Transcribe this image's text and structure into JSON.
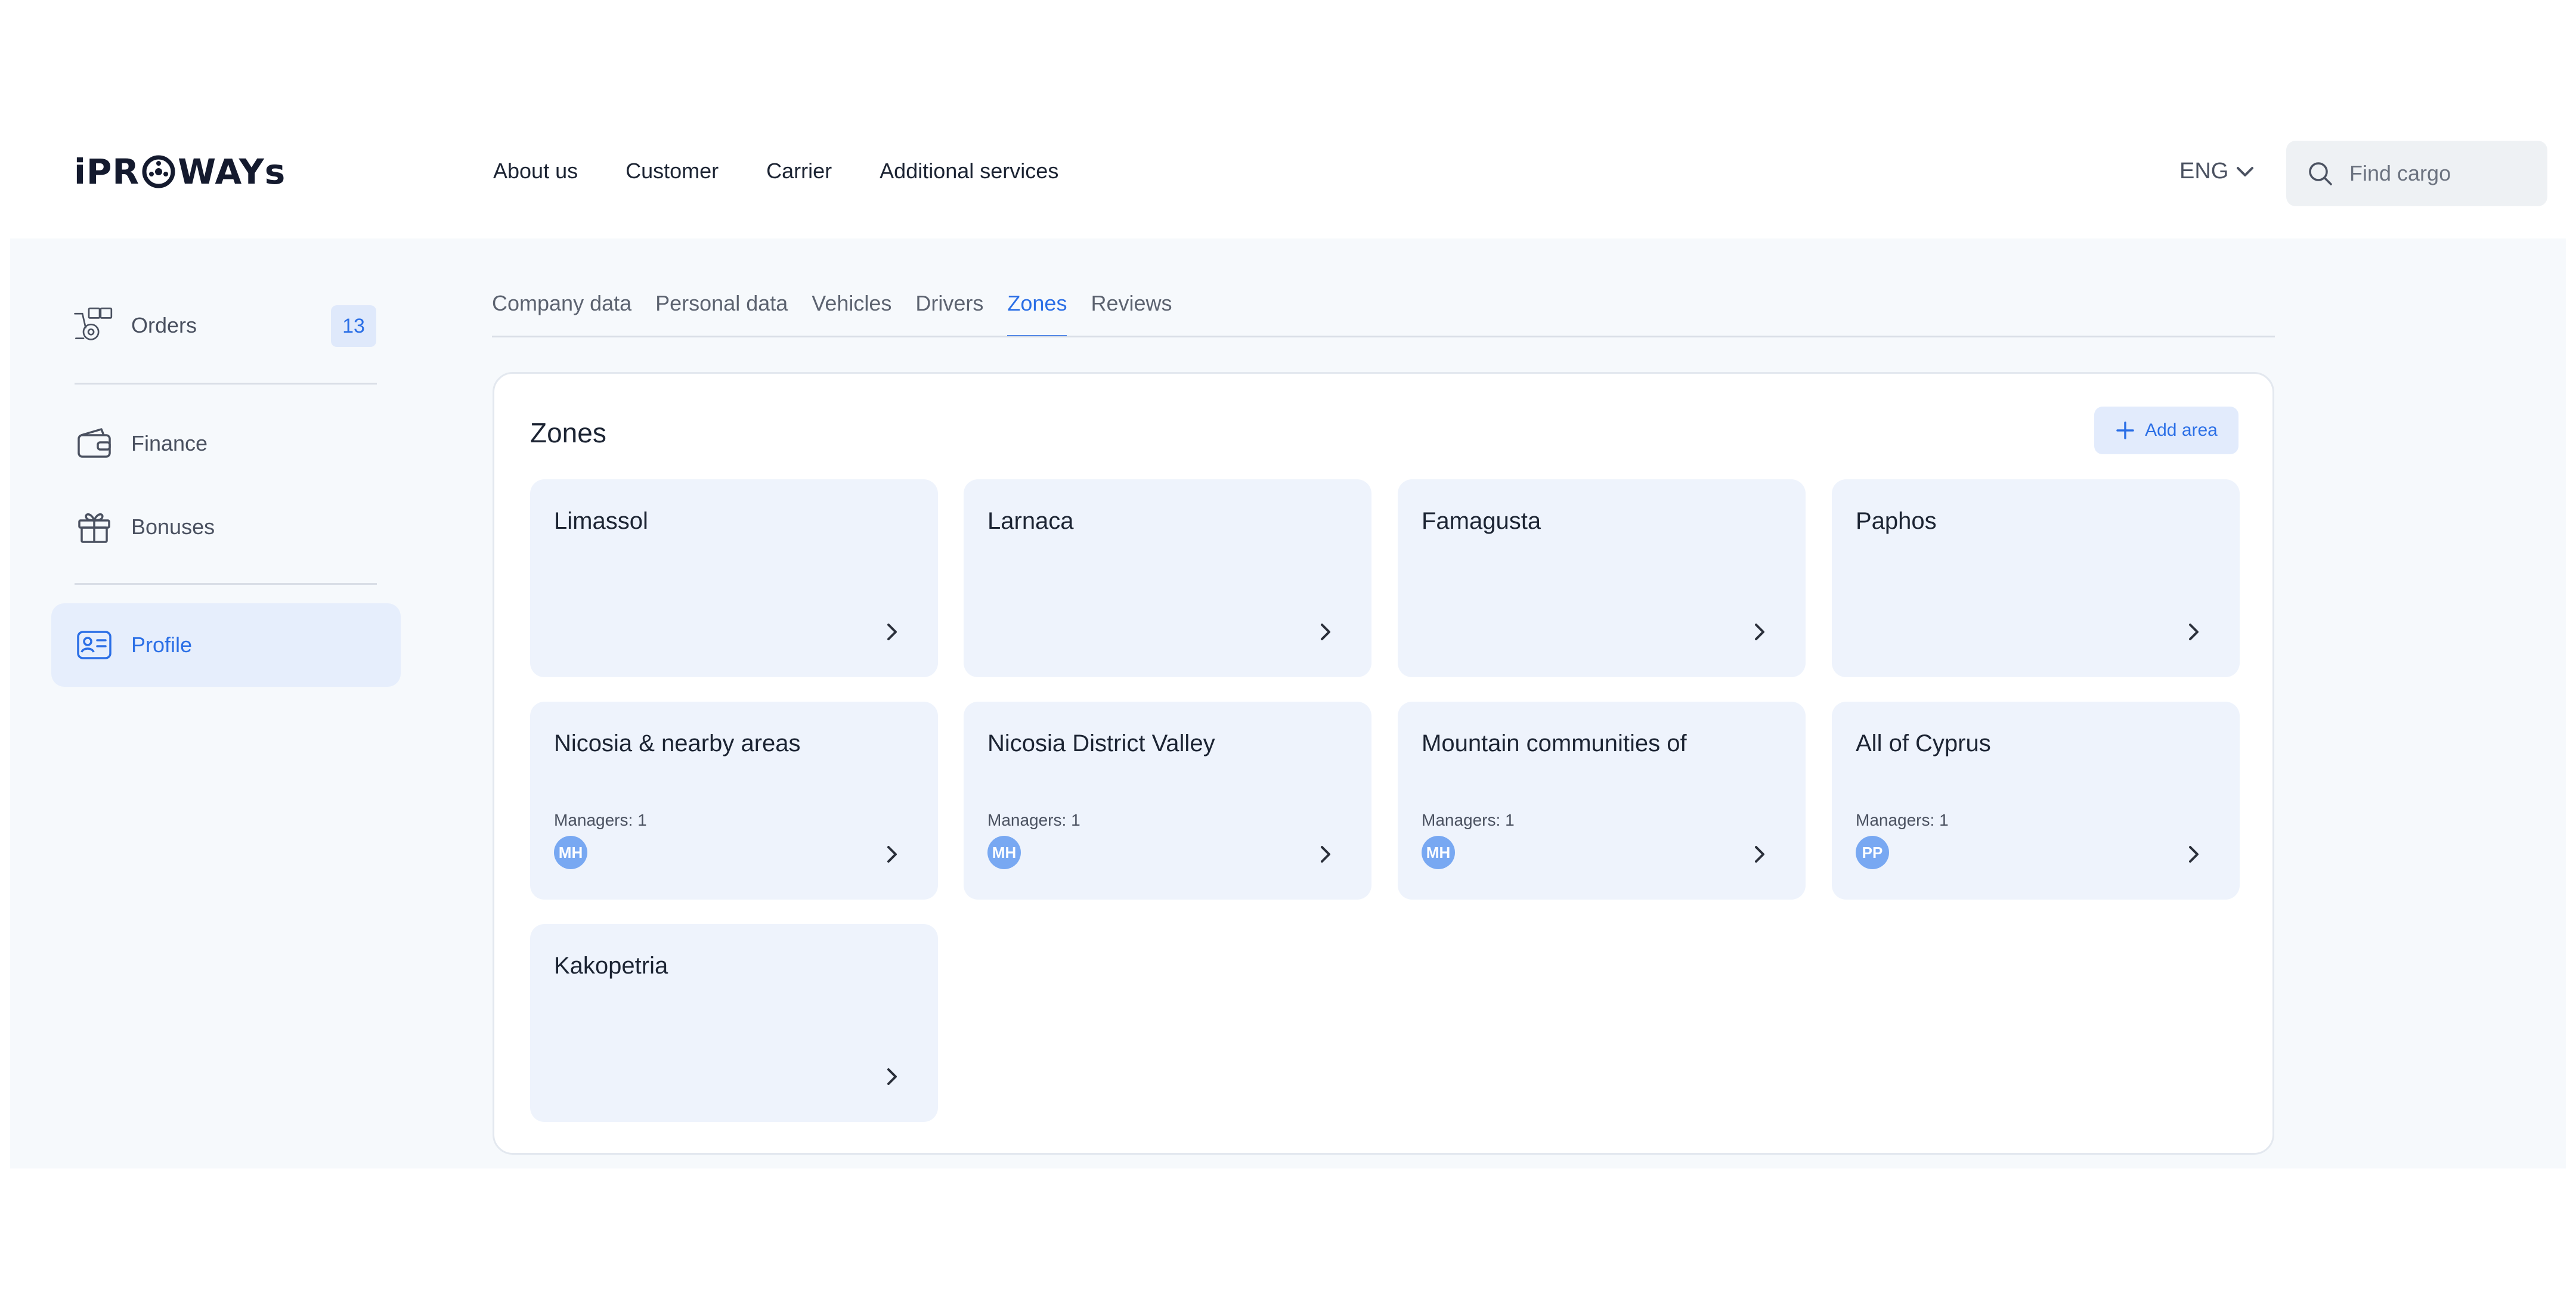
{
  "header": {
    "logo": {
      "pre": "iPR",
      "post": "WAYs"
    },
    "nav": [
      "About us",
      "Customer",
      "Carrier",
      "Additional services"
    ],
    "lang": "ENG",
    "search": {
      "placeholder": "Find cargo",
      "value": ""
    }
  },
  "sidebar": {
    "items": [
      {
        "label": "Orders",
        "icon": "orders-icon",
        "badge": "13"
      },
      {
        "label": "Finance",
        "icon": "wallet-icon"
      },
      {
        "label": "Bonuses",
        "icon": "gift-icon"
      },
      {
        "label": "Profile",
        "icon": "profile-card-icon",
        "active": true
      }
    ]
  },
  "tabs": {
    "items": [
      "Company data",
      "Personal data",
      "Vehicles",
      "Drivers",
      "Zones",
      "Reviews"
    ],
    "active": "Zones"
  },
  "zones": {
    "title": "Zones",
    "add_label": "Add area",
    "cards": [
      {
        "name": "Limassol"
      },
      {
        "name": "Larnaca"
      },
      {
        "name": "Famagusta"
      },
      {
        "name": "Paphos"
      },
      {
        "name": "Nicosia & nearby areas",
        "managers": "Managers: 1",
        "avatar": "MH"
      },
      {
        "name": "Nicosia District Valley",
        "managers": "Managers: 1",
        "avatar": "MH"
      },
      {
        "name": "Mountain communities of",
        "managers": "Managers: 1",
        "avatar": "MH"
      },
      {
        "name": "All of Cyprus",
        "managers": "Managers: 1",
        "avatar": "PP"
      },
      {
        "name": "Kakopetria"
      }
    ]
  },
  "colors": {
    "accent": "#2b6fe6",
    "card_bg": "#eef3fc",
    "page_bg": "#f6f9fc",
    "avatar": "#78a8f2"
  }
}
